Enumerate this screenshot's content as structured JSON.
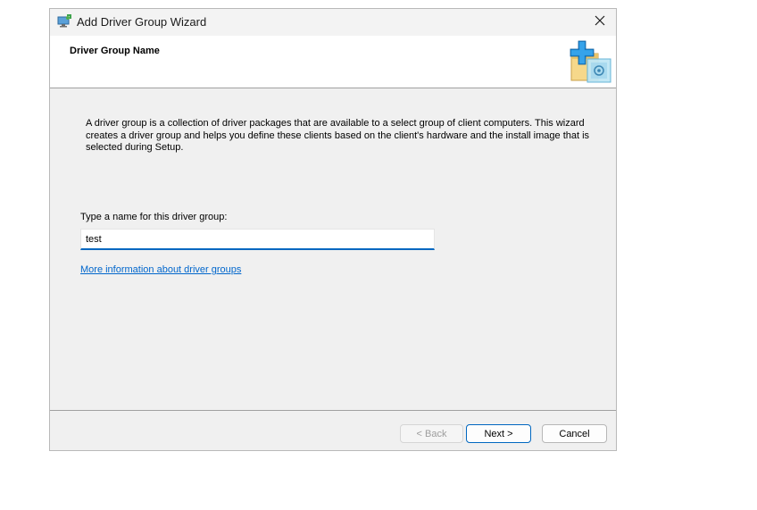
{
  "window": {
    "title": "Add Driver Group Wizard"
  },
  "header": {
    "heading": "Driver Group Name"
  },
  "body": {
    "description": "A driver group is a collection of driver packages that are available to a select group of client computers. This wizard creates a driver group and helps you define these clients based on the client's hardware and the install image that is selected during Setup.",
    "name_label": "Type a name for this driver group:",
    "name_value": "test",
    "info_link": "More information about driver groups"
  },
  "buttons": {
    "back": "< Back",
    "next": "Next >",
    "cancel": "Cancel"
  },
  "icons": {
    "title": "wizard-computer-icon",
    "close": "close-icon",
    "header": "driver-group-package-icon"
  },
  "colors": {
    "accent": "#0067c0",
    "link": "#0066cc"
  }
}
